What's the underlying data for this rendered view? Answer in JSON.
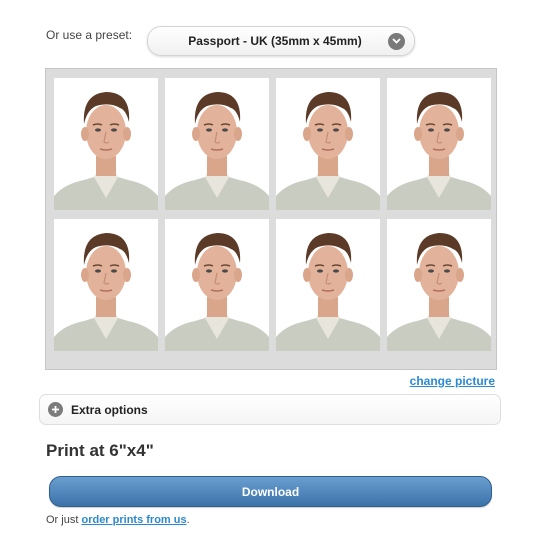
{
  "preset": {
    "label": "Or use a preset:",
    "selected": "Passport - UK (35mm x 45mm)",
    "icon": "chevron-down-icon"
  },
  "photos": {
    "count": 8,
    "columns": 4,
    "rows": 2
  },
  "change_picture": "change picture",
  "extra_options": {
    "label": "Extra options",
    "icon": "plus-circle-icon"
  },
  "print_heading": "Print at 6\"x4\"",
  "download_label": "Download",
  "order": {
    "prefix": "Or just",
    "link": "order prints from us",
    "suffix": "."
  },
  "colors": {
    "link": "#2a8ad0",
    "download_top": "#6a9ed0",
    "download_bottom": "#3b73a9"
  }
}
